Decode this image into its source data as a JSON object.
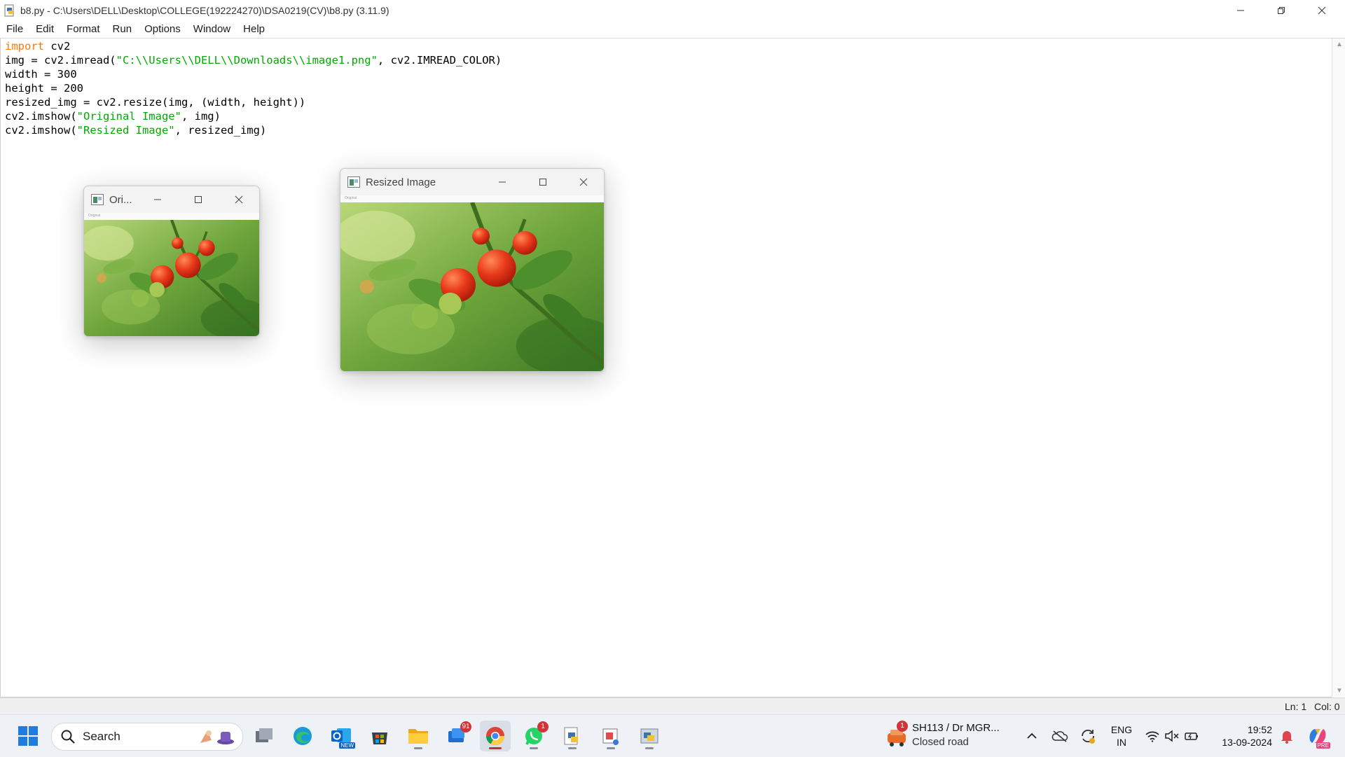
{
  "window": {
    "title": "b8.py - C:\\Users\\DELL\\Desktop\\COLLEGE(192224270)\\DSA0219(CV)\\b8.py (3.11.9)"
  },
  "menu": [
    "File",
    "Edit",
    "Format",
    "Run",
    "Options",
    "Window",
    "Help"
  ],
  "code": {
    "line1_kw": "import",
    "line1_rest": " cv2",
    "line2_a": "img = cv2.imread(",
    "line2_str": "\"C:\\\\Users\\\\DELL\\\\Downloads\\\\image1.png\"",
    "line2_b": ", cv2.IMREAD_COLOR)",
    "line3": "width = 300",
    "line4": "height = 200",
    "line5": "resized_img = cv2.resize(img, (width, height))",
    "line6_a": "cv2.imshow(",
    "line6_str": "\"Original Image\"",
    "line6_b": ", img)",
    "line7_a": "cv2.imshow(",
    "line7_str": "\"Resized Image\"",
    "line7_b": ", resized_img)"
  },
  "status": {
    "line": "Ln: 1",
    "col": "Col: 0"
  },
  "windows": {
    "original_title": "Ori...",
    "resized_title": "Resized Image",
    "inner_label": "Original"
  },
  "taskbar": {
    "search_label": "Search",
    "outlook_badge": "NEW",
    "mail_badge": "91",
    "whatsapp_badge": "1",
    "weather_badge": "1",
    "weather_title": "SH113 / Dr MGR...",
    "weather_sub": "Closed road",
    "lang_1": "ENG",
    "lang_2": "IN",
    "time": "19:52",
    "date": "13-09-2024",
    "copilot_badge": "PRE"
  },
  "colors": {
    "keyword": "#ff7700",
    "string": "#00aa00",
    "badge": "#d13438"
  }
}
